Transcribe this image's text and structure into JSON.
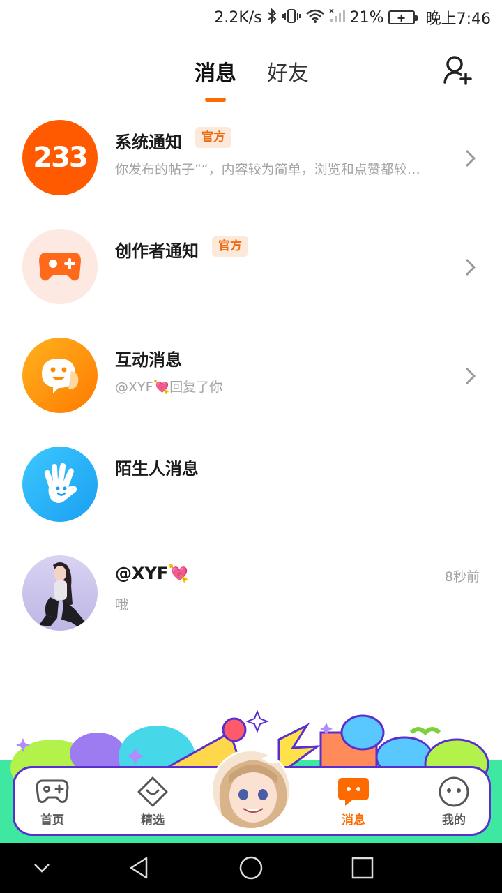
{
  "status_bar": {
    "net_speed": "2.2K/s",
    "battery": "21%",
    "time": "晚上7:46"
  },
  "header": {
    "tabs": [
      {
        "label": "消息",
        "active": true
      },
      {
        "label": "好友",
        "active": false
      }
    ],
    "add_friend_icon": "add-user-icon"
  },
  "messages": [
    {
      "title": "系统通知",
      "badge": "官方",
      "subtitle": "你发布的帖子”“，内容较为简单，浏览和点赞都较…",
      "avatar_text": "233",
      "has_chevron": true
    },
    {
      "title": "创作者通知",
      "badge": "官方",
      "subtitle": "",
      "has_chevron": true
    },
    {
      "title": "互动消息",
      "subtitle": "@XYF💘回复了你",
      "has_chevron": true
    },
    {
      "title": "陌生人消息",
      "subtitle": ""
    },
    {
      "title": "@XYF💘",
      "subtitle": "哦",
      "time": "8秒前"
    }
  ],
  "bottom_nav": [
    {
      "label": "首页",
      "icon": "gamepad-icon"
    },
    {
      "label": "精选",
      "icon": "heart-box-icon"
    },
    {
      "label": "消息",
      "icon": "chat-bubble-icon",
      "active": true
    },
    {
      "label": "我的",
      "icon": "face-icon"
    }
  ],
  "colors": {
    "accent": "#ff6a00",
    "nav_border": "#5a2fcf",
    "subtitle": "#a3a3a3"
  }
}
